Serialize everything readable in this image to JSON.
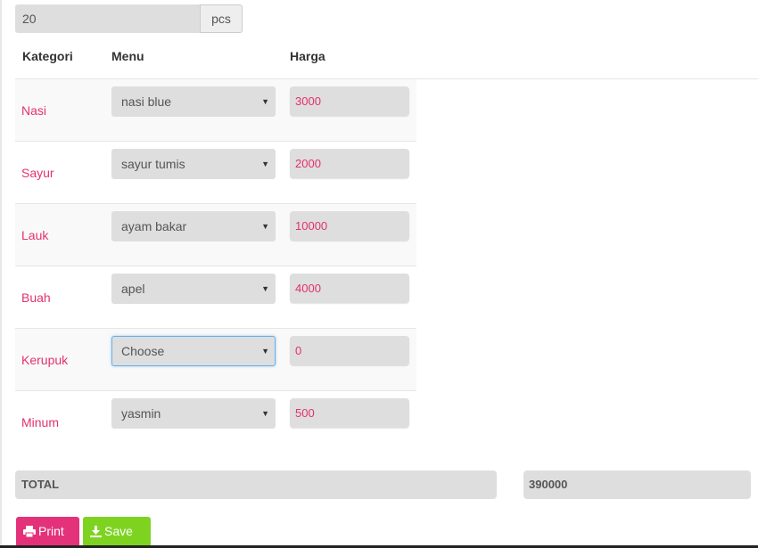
{
  "quantity": {
    "value": "20",
    "unit": "pcs"
  },
  "table": {
    "headers": {
      "category": "Kategori",
      "menu": "Menu",
      "price": "Harga"
    },
    "rows": [
      {
        "category": "Nasi",
        "menu": "nasi blue",
        "price": "3000"
      },
      {
        "category": "Sayur",
        "menu": "sayur tumis",
        "price": "2000"
      },
      {
        "category": "Lauk",
        "menu": "ayam bakar",
        "price": "10000"
      },
      {
        "category": "Buah",
        "menu": "apel",
        "price": "4000"
      },
      {
        "category": "Kerupuk",
        "menu": "Choose",
        "price": "0"
      },
      {
        "category": "Minum",
        "menu": "yasmin",
        "price": "500"
      }
    ]
  },
  "total": {
    "label": "TOTAL",
    "value": "390000"
  },
  "buttons": {
    "print": "Print",
    "save": "Save"
  },
  "colors": {
    "accent": "#e3316f",
    "print_button": "#e3317a",
    "save_button": "#7ed321",
    "field_bg": "#dedede"
  },
  "icons": {
    "print": "print-icon",
    "save": "download-icon",
    "select_caret": "caret-down-icon"
  }
}
